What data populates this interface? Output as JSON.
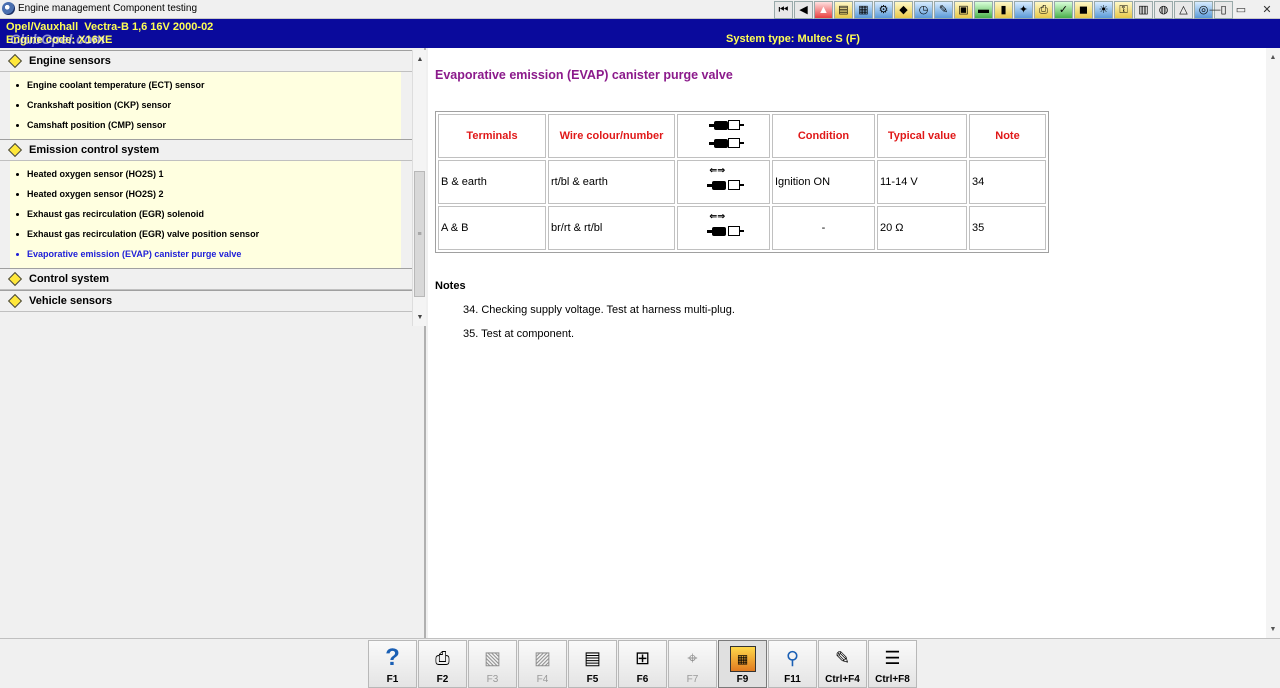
{
  "window": {
    "title": "Engine management Component testing",
    "controls": [
      "minimize",
      "maximize",
      "close"
    ]
  },
  "toolbar": {
    "icons": [
      "first-page-icon",
      "previous-page-icon",
      "warning-icon",
      "book-icon",
      "data-icon",
      "settings-icon",
      "vehicle-icon",
      "clock-icon",
      "wrench-icon",
      "engine-icon",
      "car-icon",
      "battery-icon",
      "tools-icon",
      "printer-icon",
      "tick-icon",
      "lock-icon",
      "light-icon",
      "key-icon",
      "document-icon",
      "globe-icon",
      "warning-triangle-icon",
      "sensor-icon",
      "note-icon"
    ]
  },
  "vehicle": {
    "make": "Opel/Vauxhall",
    "model_line": "Vectra-B  1,6 16V 2000-02",
    "engine_label": "Engine code:",
    "engine_code": "X16XE",
    "system_type": "System type: Multec S (F)",
    "watermark": "ClubOpel.com"
  },
  "tree": {
    "groups": [
      {
        "label": "Engine sensors",
        "items": [
          "Engine coolant temperature (ECT) sensor",
          "Crankshaft position (CKP) sensor",
          "Camshaft position (CMP) sensor"
        ]
      },
      {
        "label": "Emission control system",
        "items": [
          "Heated oxygen sensor (HO2S) 1",
          "Heated oxygen sensor (HO2S) 2",
          "Exhaust gas recirculation (EGR) solenoid",
          "Exhaust gas recirculation (EGR) valve position sensor",
          "Evaporative emission (EVAP) canister purge valve"
        ],
        "active_index": 4
      },
      {
        "label": "Control system"
      },
      {
        "label": "Vehicle sensors"
      }
    ]
  },
  "content": {
    "title": "Evaporative emission (EVAP) canister purge valve",
    "table": {
      "headers": {
        "terminals": "Terminals",
        "wire": "Wire colour/number",
        "condition": "Condition",
        "typical": "Typical value",
        "note": "Note"
      },
      "rows": [
        {
          "terminals": "B & earth",
          "wire": "rt/bl & earth",
          "condition": "Ignition ON",
          "typical": "11-14 V",
          "note": "34"
        },
        {
          "terminals": "A & B",
          "wire": "br/rt & rt/bl",
          "condition": "-",
          "typical": "20 Ω",
          "note": "35"
        }
      ]
    },
    "notes_title": "Notes",
    "notes": [
      "34. Checking supply voltage. Test at harness multi-plug.",
      "35. Test at component."
    ]
  },
  "function_keys": [
    {
      "label": "F1",
      "icon": "help-icon",
      "enabled": true
    },
    {
      "label": "F2",
      "icon": "printer-icon",
      "enabled": true
    },
    {
      "label": "F3",
      "icon": "wiring-icon",
      "enabled": false
    },
    {
      "label": "F4",
      "icon": "wiring-detail-icon",
      "enabled": false
    },
    {
      "label": "F5",
      "icon": "component-location-icon",
      "enabled": true
    },
    {
      "label": "F6",
      "icon": "connector-icon",
      "enabled": true
    },
    {
      "label": "F7",
      "icon": "probe-icon",
      "enabled": false
    },
    {
      "label": "F9",
      "icon": "codes-icon",
      "enabled": true,
      "pressed": true
    },
    {
      "label": "F11",
      "icon": "search-icon",
      "enabled": true
    },
    {
      "label": "Ctrl+F4",
      "icon": "notepad-icon",
      "enabled": true
    },
    {
      "label": "Ctrl+F8",
      "icon": "table-icon",
      "enabled": true
    }
  ]
}
